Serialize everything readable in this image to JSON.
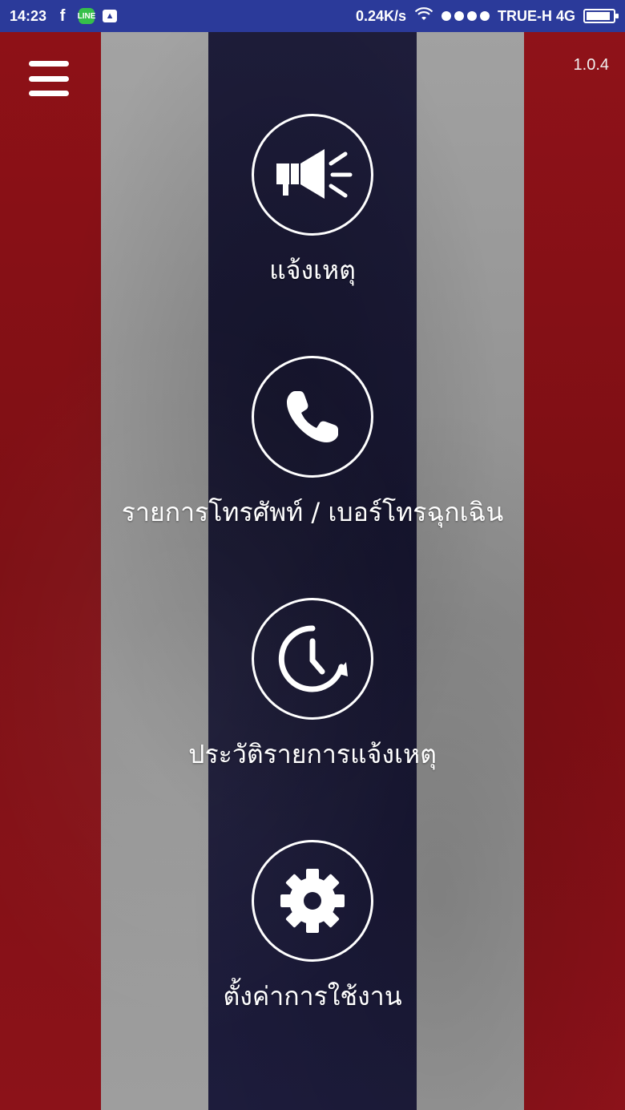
{
  "status_bar": {
    "time": "14:23",
    "net_speed": "0.24K/s",
    "carrier": "TRUE-H 4G",
    "battery_level": 0.9,
    "left_icons": [
      "facebook-icon",
      "line-icon",
      "photo-icon"
    ],
    "right_icons": [
      "wifi-icon",
      "signal-icon",
      "battery-icon"
    ]
  },
  "header": {
    "menu_icon": "hamburger-menu-icon",
    "version": "1.0.4"
  },
  "menu": {
    "items": [
      {
        "label": "แจ้งเหตุ",
        "icon": "megaphone-icon"
      },
      {
        "label": "รายการโทรศัพท์ / เบอร์โทรฉุกเฉิน",
        "icon": "phone-icon"
      },
      {
        "label": "ประวัติรายการแจ้งเหตุ",
        "icon": "history-clock-icon"
      },
      {
        "label": "ตั้งค่าการใช้งาน",
        "icon": "gear-icon"
      }
    ]
  },
  "colors": {
    "status_bar": "#2b3a9a",
    "flag_red": "#8c1319",
    "flag_gray": "#9a9a9a",
    "flag_navy": "#1b1a36",
    "foreground": "#ffffff"
  }
}
